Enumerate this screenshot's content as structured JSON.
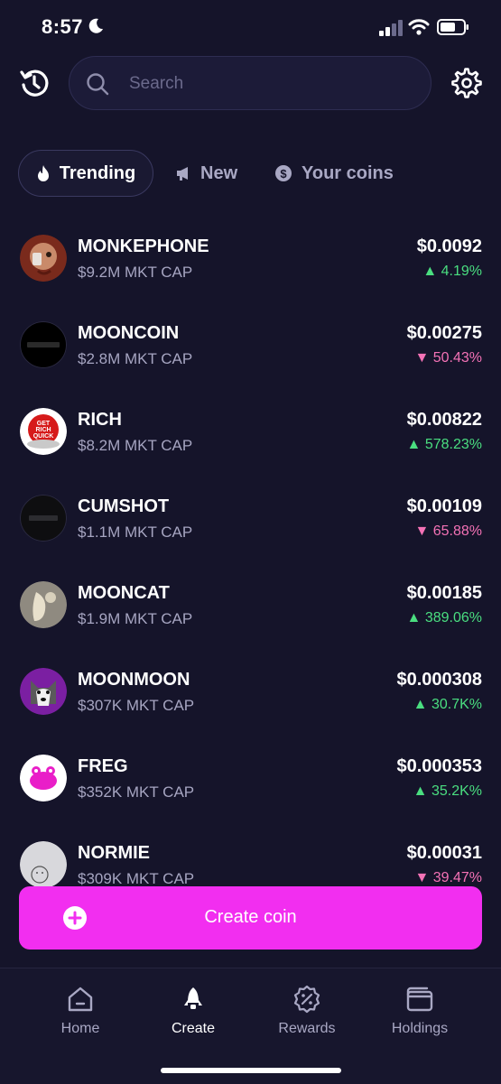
{
  "status": {
    "time": "8:57"
  },
  "search": {
    "placeholder": "Search"
  },
  "tabs": [
    {
      "label": "Trending",
      "icon": "flame-icon",
      "active": true
    },
    {
      "label": "New",
      "icon": "megaphone-icon",
      "active": false
    },
    {
      "label": "Your coins",
      "icon": "coin-icon",
      "active": false
    }
  ],
  "coins": [
    {
      "name": "MONKEPHONE",
      "cap": "$9.2M MKT CAP",
      "price": "$0.0092",
      "change": "4.19%",
      "direction": "up"
    },
    {
      "name": "MOONCOIN",
      "cap": "$2.8M MKT CAP",
      "price": "$0.00275",
      "change": "50.43%",
      "direction": "down"
    },
    {
      "name": "RICH",
      "cap": "$8.2M MKT CAP",
      "price": "$0.00822",
      "change": "578.23%",
      "direction": "up"
    },
    {
      "name": "CUMSHOT",
      "cap": "$1.1M MKT CAP",
      "price": "$0.00109",
      "change": "65.88%",
      "direction": "down"
    },
    {
      "name": "MOONCAT",
      "cap": "$1.9M MKT CAP",
      "price": "$0.00185",
      "change": "389.06%",
      "direction": "up"
    },
    {
      "name": "MOONMOON",
      "cap": "$307K MKT CAP",
      "price": "$0.000308",
      "change": "30.7K%",
      "direction": "up"
    },
    {
      "name": "FREG",
      "cap": "$352K MKT CAP",
      "price": "$0.000353",
      "change": "35.2K%",
      "direction": "up"
    },
    {
      "name": "NORMIE",
      "cap": "$309K MKT CAP",
      "price": "$0.00031",
      "change": "39.47%",
      "direction": "down"
    }
  ],
  "avatar_labels": {
    "rich": "GET RICH QUICK"
  },
  "create_button": {
    "label": "Create coin"
  },
  "nav": [
    {
      "label": "Home",
      "icon": "home-icon",
      "active": false
    },
    {
      "label": "Create",
      "icon": "rocket-icon",
      "active": true
    },
    {
      "label": "Rewards",
      "icon": "percent-badge-icon",
      "active": false
    },
    {
      "label": "Holdings",
      "icon": "wallet-icon",
      "active": false
    }
  ],
  "colors": {
    "background": "#15142a",
    "accent": "#f22ef0",
    "up": "#4ade80",
    "down": "#f472b6"
  }
}
